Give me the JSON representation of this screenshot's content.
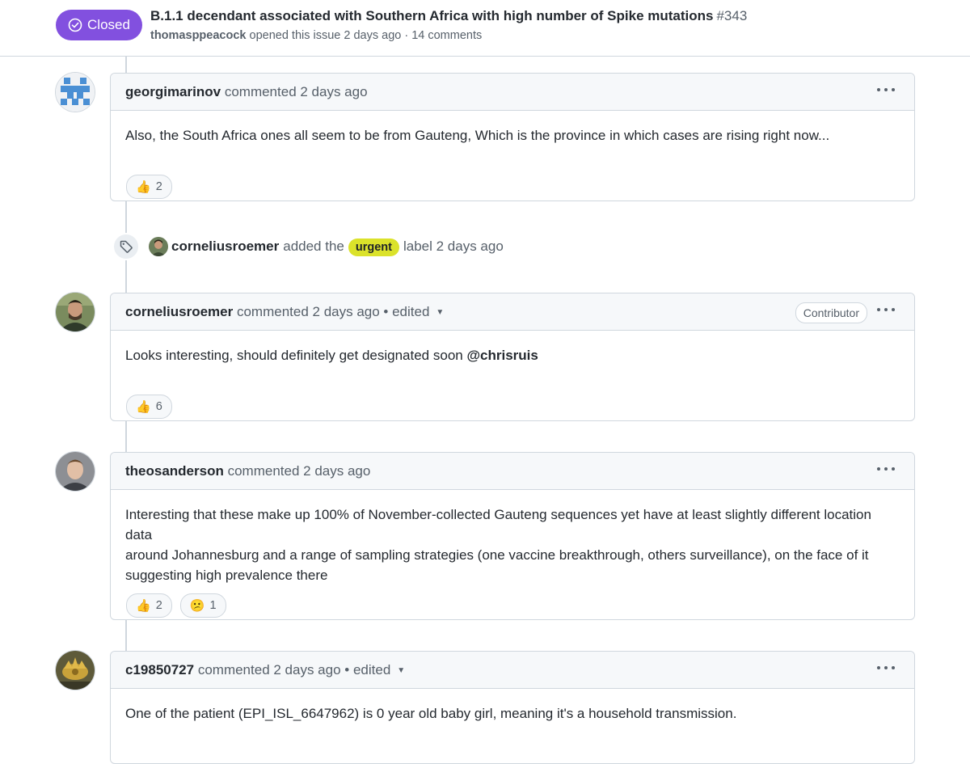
{
  "issue": {
    "state": "Closed",
    "title": "B.1.1 decendant associated with Southern Africa with high number of Spike mutations",
    "number": "#343",
    "author": "thomasppeacock",
    "meta_rest": "opened this issue 2 days ago · 14 comments"
  },
  "comments": [
    {
      "author": "georgimarinov",
      "action": "commented 2 days ago",
      "edited": "",
      "role": "",
      "body": [
        "Also, the South Africa ones all seem to be from Gauteng, Which is the province in which cases are rising right now..."
      ],
      "mention": "",
      "reactions": [
        {
          "emoji": "👍",
          "name": "thumbs-up",
          "count": "2"
        }
      ]
    },
    {
      "author": "corneliusroemer",
      "action": "commented 2 days ago",
      "edited": "• edited",
      "role": "Contributor",
      "body": [
        "Looks interesting, should definitely get designated soon"
      ],
      "mention": "@chrisruis",
      "reactions": [
        {
          "emoji": "👍",
          "name": "thumbs-up",
          "count": "6"
        }
      ]
    },
    {
      "author": "theosanderson",
      "action": "commented 2 days ago",
      "edited": "",
      "role": "",
      "body": [
        "Interesting that these make up 100% of November-collected Gauteng sequences yet have at least slightly different location data",
        "around Johannesburg and a range of sampling strategies (one vaccine breakthrough, others surveillance), on the face of it",
        "suggesting high prevalence there"
      ],
      "mention": "",
      "reactions": [
        {
          "emoji": "👍",
          "name": "thumbs-up",
          "count": "2"
        },
        {
          "emoji": "😕",
          "name": "confused",
          "count": "1"
        }
      ]
    },
    {
      "author": "c19850727",
      "action": "commented 2 days ago",
      "edited": "• edited",
      "role": "",
      "body": [
        "One of the patient (EPI_ISL_6647962) is 0 year old baby girl, meaning it's a household transmission."
      ],
      "mention": "",
      "reactions": []
    }
  ],
  "label_event": {
    "actor": "corneliusroemer",
    "verb": "added the",
    "label": "urgent",
    "label_color": "#dbe22a",
    "suffix": "label 2 days ago"
  },
  "colors": {
    "closed_purple": "#8250df",
    "border": "#d0d7de",
    "muted_text": "#57606a"
  }
}
